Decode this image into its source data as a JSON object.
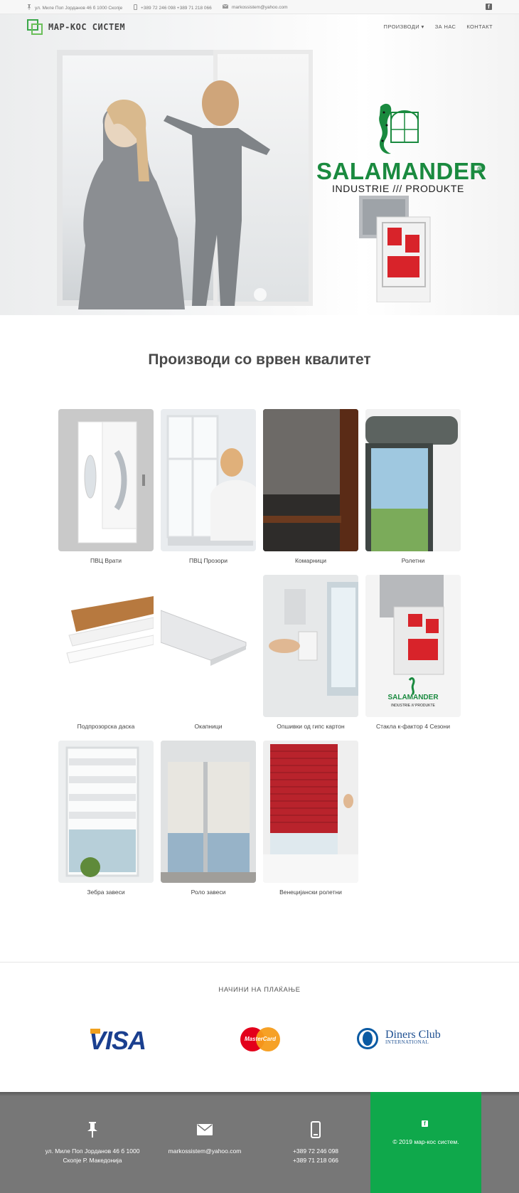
{
  "topbar": {
    "address": "ул. Миле Поп Јорданов 46 б 1000 Скопје",
    "phones": "+389 72 246 098 +389 71 218 066",
    "email": "markossistem@yahoo.com",
    "address_icon": "pin-icon",
    "phone_icon": "phone-icon",
    "email_icon": "envelope-icon",
    "social_icon": "facebook-icon"
  },
  "header": {
    "logo_text": "МАР-КОС СИСТЕМ",
    "nav": [
      {
        "label": "ПРОИЗВОДИ",
        "caret": "▾"
      },
      {
        "label": "ЗА НАС"
      },
      {
        "label": "КОНТАКТ"
      }
    ]
  },
  "hero": {
    "brand_name": "SALAMANDER",
    "brand_reg": "®",
    "brand_sub": "INDUSTRIE /// PRODUKTE",
    "brand_color": "#1a8a3f"
  },
  "products": {
    "title": "Производи со врвен квалитет",
    "items": [
      {
        "label": "ПВЦ Врати",
        "icon": "door-image"
      },
      {
        "label": "ПВЦ Прозори",
        "icon": "window-image"
      },
      {
        "label": "Комарници",
        "icon": "mosquito-net-image"
      },
      {
        "label": "Ролетни",
        "icon": "shutter-image"
      },
      {
        "label": "Подпрозорска даска",
        "icon": "sill-board-image"
      },
      {
        "label": "Окапници",
        "icon": "drip-edge-image"
      },
      {
        "label": "Опшивки од гипс картон",
        "icon": "drywall-image"
      },
      {
        "label": "Стакла к-фактор 4 Сезони",
        "icon": "glass-profile-image"
      },
      {
        "label": "Зебра завеси",
        "icon": "zebra-blind-image"
      },
      {
        "label": "Роло завеси",
        "icon": "roller-blind-image"
      },
      {
        "label": "Венецијански ролетни",
        "icon": "venetian-blind-image"
      }
    ]
  },
  "payment": {
    "title": "НАЧИНИ НА ПЛАЌАЊЕ",
    "visa": "VISA",
    "mastercard": "MasterCard",
    "diners_main": "Diners Club",
    "diners_sub": "INTERNATIONAL"
  },
  "footer": {
    "address_line1": "ул. Миле Поп Јорданов 46 б 1000",
    "address_line2": "Скопје Р. Македонија",
    "email": "markossistem@yahoo.com",
    "phone1": "+389 72 246 098",
    "phone2": "+389 71 218 066",
    "copyright": "© 2019 мар-кос систем.",
    "accent_color": "#0fa84b",
    "bg_color": "#777777"
  }
}
